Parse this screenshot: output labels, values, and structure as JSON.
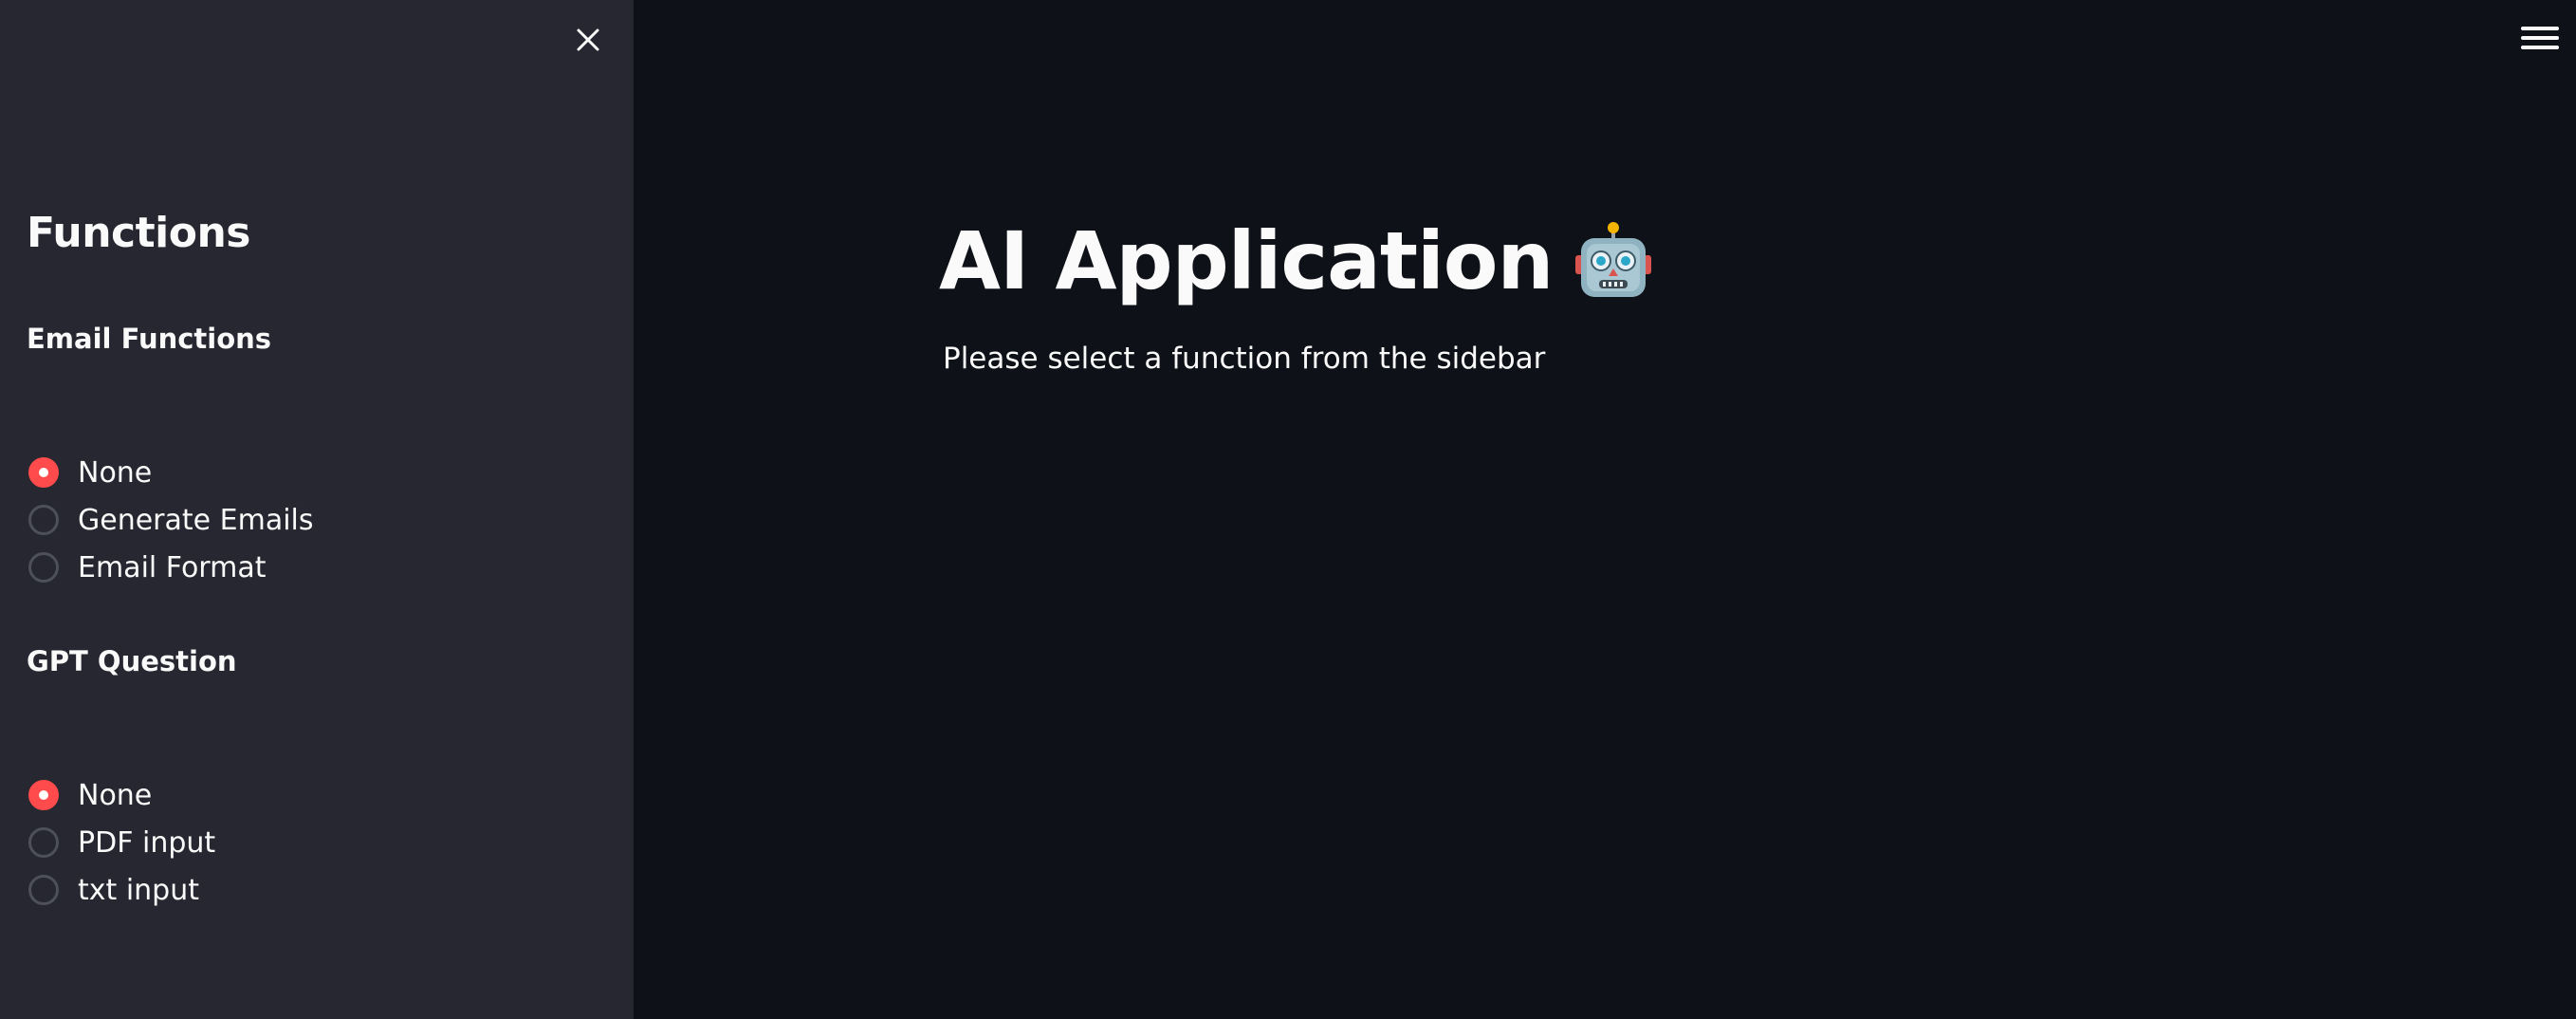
{
  "sidebar": {
    "close_icon": "close-icon",
    "title": "Functions",
    "sections": [
      {
        "title": "Email Functions",
        "options": [
          "None",
          "Generate Emails",
          "Email Format"
        ],
        "selected": "None"
      },
      {
        "title": "GPT Question",
        "options": [
          "None",
          "PDF input",
          "txt input"
        ],
        "selected": "None"
      }
    ]
  },
  "main": {
    "menu_icon": "hamburger-menu-icon",
    "title": "AI Application",
    "title_icon": "robot-icon",
    "subtitle": "Please select a function from the sidebar"
  },
  "colors": {
    "main_bg": "#0e1117",
    "sidebar_bg": "#262730",
    "accent": "#ff4b4b",
    "text": "#fafafa"
  }
}
